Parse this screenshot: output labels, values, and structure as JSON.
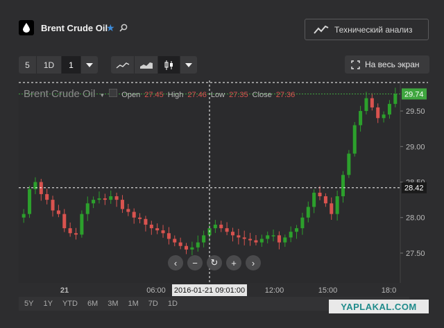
{
  "header": {
    "title": "Brent Crude Oil",
    "tech_label": "Технический анализ",
    "fullscreen_label": "На весь экран"
  },
  "toolbar": {
    "interval_buttons": [
      "5",
      "1D",
      "1"
    ],
    "chart_type_icons": [
      "line-chart-icon",
      "area-chart-icon",
      "candle-chart-icon"
    ]
  },
  "legend": {
    "name": "Brent Crude Oil",
    "open_label": "Open",
    "open": "27.45",
    "high_label": "High",
    "high": "27.46",
    "low_label": "Low",
    "low": "27.35",
    "close_label": "Close",
    "close": "27.36"
  },
  "crosshair": {
    "x_label": "2016-01-21 09:01:00",
    "y_label": "28.42",
    "last_price": "29.74"
  },
  "ranges": [
    "5Y",
    "1Y",
    "YTD",
    "6M",
    "3M",
    "1M",
    "7D",
    "1D"
  ],
  "watermark": "YAPLAKAL.COM",
  "colors": {
    "up": "#2ca02c",
    "down": "#d9534f",
    "accent": "#3d8bd9",
    "last_price": "#3fa63f"
  },
  "chart_data": {
    "type": "candlestick",
    "title": "Brent Crude Oil",
    "ylim": [
      27.08,
      29.93
    ],
    "y_ticks": [
      "29.50",
      "29.00",
      "28.50",
      "28.00",
      "27.50"
    ],
    "x_ticks": [
      "21",
      "06:00",
      "09:00",
      "12:00",
      "15:00",
      "18:0"
    ],
    "series": [
      {
        "name": "Brent Crude Oil",
        "values": [
          28.05,
          28.4,
          28.5,
          28.33,
          28.25,
          28.1,
          28.05,
          27.85,
          27.78,
          27.76,
          28.05,
          28.2,
          28.25,
          28.27,
          28.25,
          28.3,
          28.25,
          28.12,
          28.08,
          28.0,
          27.98,
          27.9,
          27.85,
          27.82,
          27.78,
          27.7,
          27.65,
          27.6,
          27.55,
          27.58,
          27.65,
          27.75,
          27.85,
          27.9,
          27.85,
          27.8,
          27.75,
          27.72,
          27.7,
          27.68,
          27.65,
          27.7,
          27.75,
          27.75,
          27.65,
          27.72,
          27.8,
          27.85,
          28.0,
          28.15,
          28.35,
          28.3,
          28.2,
          28.05,
          28.3,
          28.6,
          28.9,
          29.3,
          29.5,
          29.68,
          29.55,
          29.4,
          29.45,
          29.6,
          29.74
        ]
      }
    ]
  }
}
